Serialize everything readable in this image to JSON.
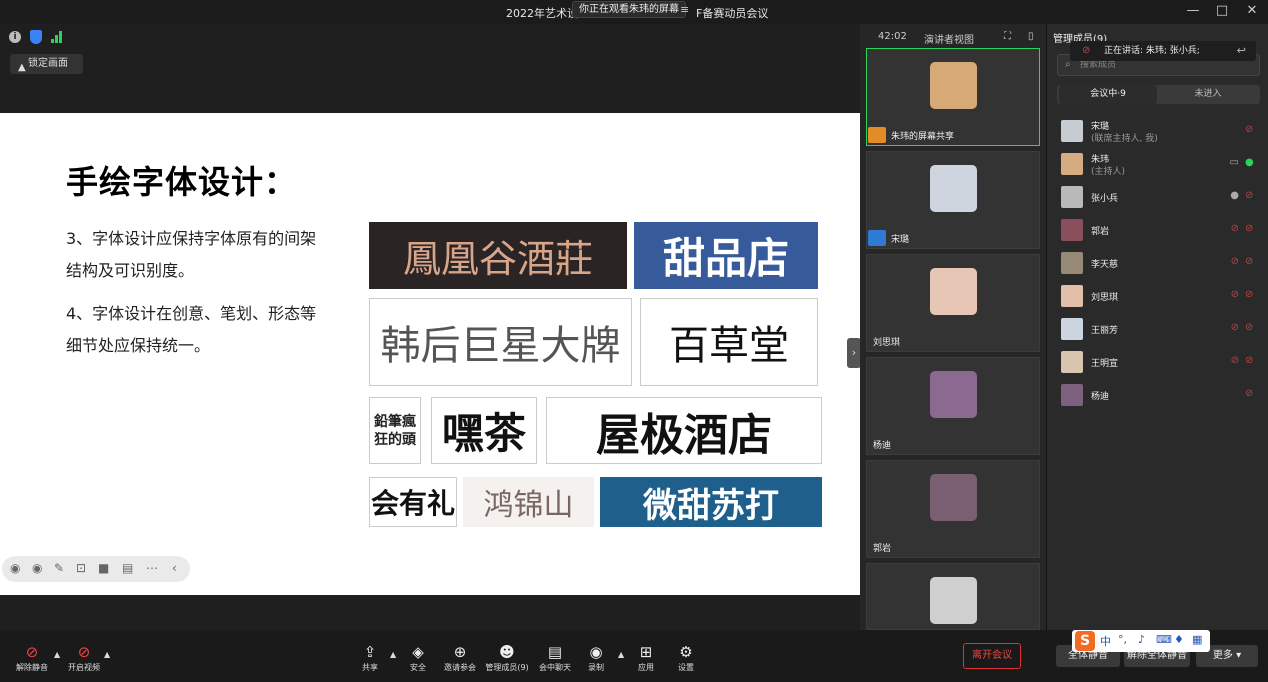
{
  "window": {
    "title": "2022年艺术设",
    "title_suffix": "F备赛动员会议",
    "share_status": "你正在观看朱玮的屏幕",
    "share_menu_icon": "≡",
    "controls": [
      "—",
      "□",
      "✕"
    ]
  },
  "top_toolbar": {
    "lock_view_label": "锁定画面",
    "timer": "42:02",
    "view_mode": "演讲者视图"
  },
  "slide": {
    "title": "手绘字体设计：",
    "point3": "3、字体设计应保持字体原有的间架结构及可识别度。",
    "point4": "4、字体设计在创意、笔划、形态等细节处应保持统一。",
    "samples": [
      "鳳凰谷酒莊",
      "甜品店",
      "韩后巨星大牌",
      "百草堂",
      "鉛筆瘋狂的頭",
      "嘿茶",
      "屋极酒店",
      "会有礼",
      "鸿锦山",
      "微甜苏打"
    ]
  },
  "video_tiles": [
    {
      "name": "朱玮的屏幕共享",
      "active": true,
      "color": "#d7a977"
    },
    {
      "name": "宋璐",
      "active": false,
      "color": "#cfd5df"
    },
    {
      "name": "刘思琪",
      "active": false,
      "color": "#e7c6b5"
    },
    {
      "name": "杨迪",
      "active": false,
      "color": "#8a6a8e"
    },
    {
      "name": "郭岩",
      "active": false,
      "color": "#7a5e72"
    },
    {
      "name": "",
      "active": false,
      "color": "#cfcfcf"
    }
  ],
  "panel": {
    "header": "管理成员(9)",
    "speaking": "正在讲话: 朱玮; 张小兵;",
    "search_placeholder": "搜索成员",
    "tab_in": "会议中·9",
    "tab_out": "未进入",
    "participants": [
      {
        "name": "宋璐",
        "sub": "(联席主持人, 我)",
        "color": "#c7ccd3",
        "mic": "off",
        "cam": ""
      },
      {
        "name": "朱玮",
        "sub": "(主持人)",
        "color": "#d5ab82",
        "mic": "on",
        "cam": "screen"
      },
      {
        "name": "张小兵",
        "sub": "",
        "color": "#b9b9b9",
        "mic": "idle",
        "cam": "off"
      },
      {
        "name": "郭岩",
        "sub": "",
        "color": "#8b4e5c",
        "mic": "off",
        "cam": "off"
      },
      {
        "name": "李天慈",
        "sub": "",
        "color": "#978b77",
        "mic": "off",
        "cam": "off"
      },
      {
        "name": "刘思琪",
        "sub": "",
        "color": "#e2bfa9",
        "mic": "off",
        "cam": "off"
      },
      {
        "name": "王丽芳",
        "sub": "",
        "color": "#cbd4df",
        "mic": "off",
        "cam": "off"
      },
      {
        "name": "王明宣",
        "sub": "",
        "color": "#d9c4b0",
        "mic": "off",
        "cam": "off"
      },
      {
        "name": "杨迪",
        "sub": "",
        "color": "#7c607e",
        "mic": "off",
        "cam": ""
      }
    ]
  },
  "bottom": {
    "unmute": "解除静音",
    "start_video": "开启视频",
    "share": "共享",
    "security": "安全",
    "invite": "邀请参会",
    "manage": "管理成员(9)",
    "chat": "会中聊天",
    "record": "录制",
    "apps": "应用",
    "settings": "设置",
    "leave": "离开会议",
    "mute_all": "全体静音",
    "unmute_all": "解除全体静音",
    "more": "更多"
  },
  "ime": {
    "logo": "S",
    "mode": "中"
  }
}
